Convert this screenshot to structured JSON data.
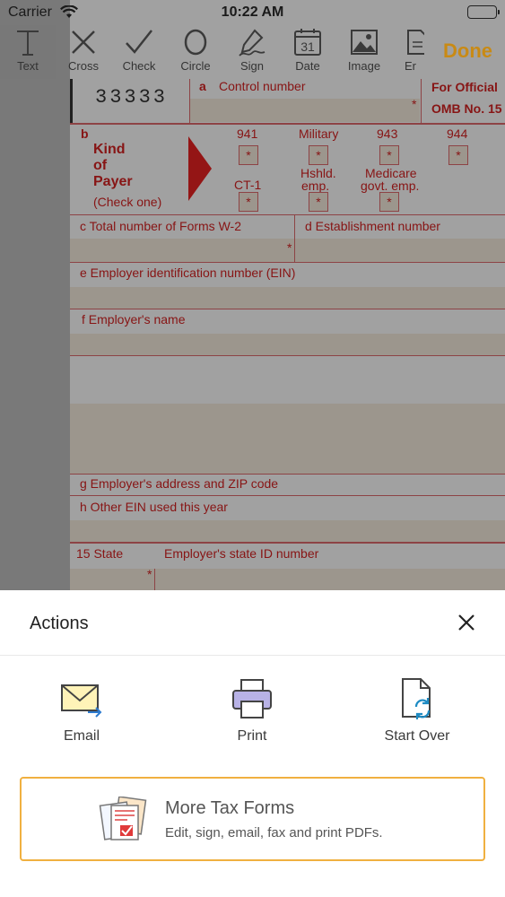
{
  "status_bar": {
    "carrier": "Carrier",
    "time": "10:22 AM"
  },
  "toolbar": {
    "tools": [
      {
        "label": "Text",
        "icon": "text-icon",
        "active": true
      },
      {
        "label": "Cross",
        "icon": "cross-icon"
      },
      {
        "label": "Check",
        "icon": "check-icon"
      },
      {
        "label": "Circle",
        "icon": "circle-icon"
      },
      {
        "label": "Sign",
        "icon": "sign-icon"
      },
      {
        "label": "Date",
        "icon": "date-icon",
        "day": "31"
      },
      {
        "label": "Image",
        "icon": "image-icon"
      },
      {
        "label": "Er",
        "icon": "eraser-icon"
      }
    ],
    "done_label": "Done",
    "accent": "#c98a14"
  },
  "form": {
    "control_code": "33333",
    "box_a_letter": "a",
    "box_a_label": "Control number",
    "official_1": "For Official",
    "official_2": "OMB No. 15",
    "box_b_letter": "b",
    "kind_1": "Kind",
    "kind_2": "of",
    "kind_3": "Payer",
    "check_one": "(Check one)",
    "cb_941": "941",
    "cb_military": "Military",
    "cb_943": "943",
    "cb_944": "944",
    "cb_ct1": "CT-1",
    "cb_hshld_1": "Hshld.",
    "cb_hshld_2": "emp.",
    "cb_medicare_1": "Medicare",
    "cb_medicare_2": "govt. emp.",
    "box_c": "c Total number of Forms W-2",
    "box_d": "d Establishment number",
    "box_e": "e Employer identification number (EIN)",
    "box_f": "f  Employer's name",
    "box_g": "g Employer's address and ZIP code",
    "box_h": "h Other EIN used this year",
    "box_15": "15 State",
    "box_15_id": "Employer's state ID number",
    "required_mark": "*",
    "form_color": "#b00000"
  },
  "sheet": {
    "title": "Actions",
    "actions": [
      {
        "label": "Email",
        "icon": "email-icon"
      },
      {
        "label": "Print",
        "icon": "printer-icon"
      },
      {
        "label": "Start Over",
        "icon": "start-over-icon"
      }
    ],
    "promo": {
      "title": "More Tax Forms",
      "subtitle": "Edit, sign, email, fax and print PDFs.",
      "border_color": "#f0b040"
    }
  }
}
